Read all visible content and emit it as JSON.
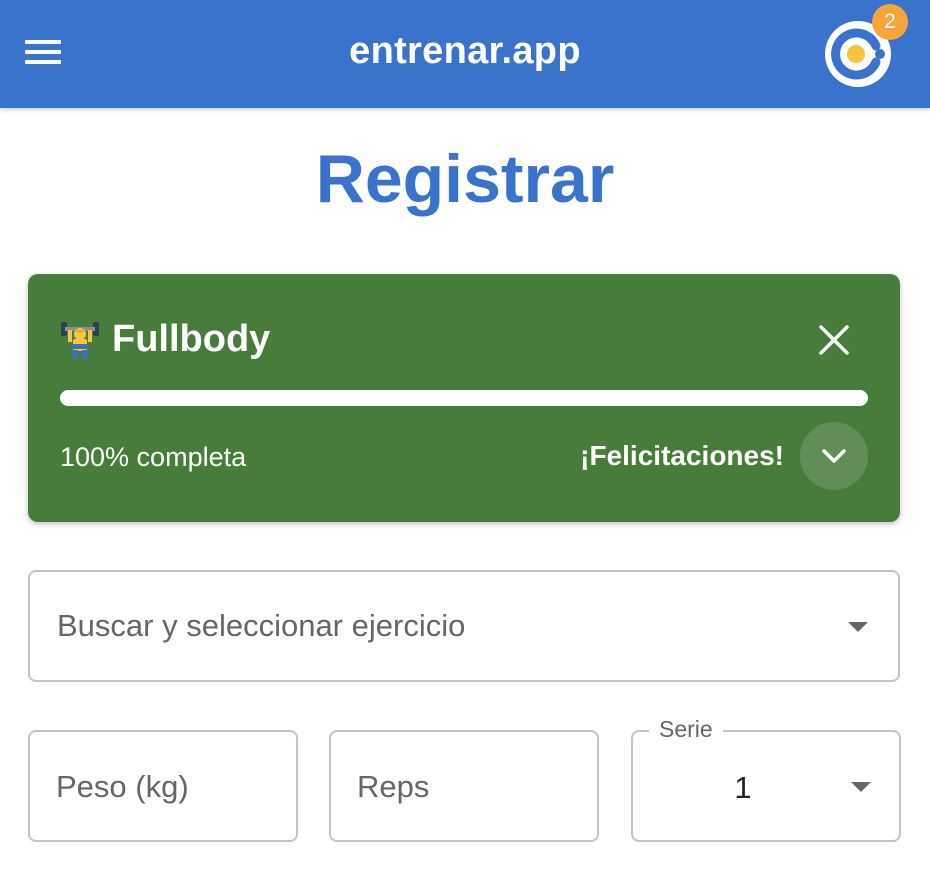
{
  "header": {
    "title": "entrenar.app",
    "menu_icon": "hamburger-menu-icon",
    "avatar_icon": "app-logo-avatar-icon",
    "notification_count": "2",
    "colors": {
      "bar": "#3a73cc",
      "badge": "#f5a53a"
    }
  },
  "page": {
    "title": "Registrar"
  },
  "workout": {
    "emoji_icon": "weightlifter-emoji-icon",
    "name": "Fullbody",
    "progress_percent": 100,
    "progress_text": "100% completa",
    "congrats": "¡Felicitaciones!",
    "close_icon": "close-icon",
    "expand_icon": "chevron-down-icon",
    "colors": {
      "card": "#477c3b"
    }
  },
  "form": {
    "exercise": {
      "placeholder": "Buscar y seleccionar ejercicio",
      "arrow_icon": "dropdown-arrow-icon"
    },
    "weight": {
      "placeholder": "Peso (kg)"
    },
    "reps": {
      "placeholder": "Reps"
    },
    "set": {
      "label": "Serie",
      "value": "1"
    }
  }
}
